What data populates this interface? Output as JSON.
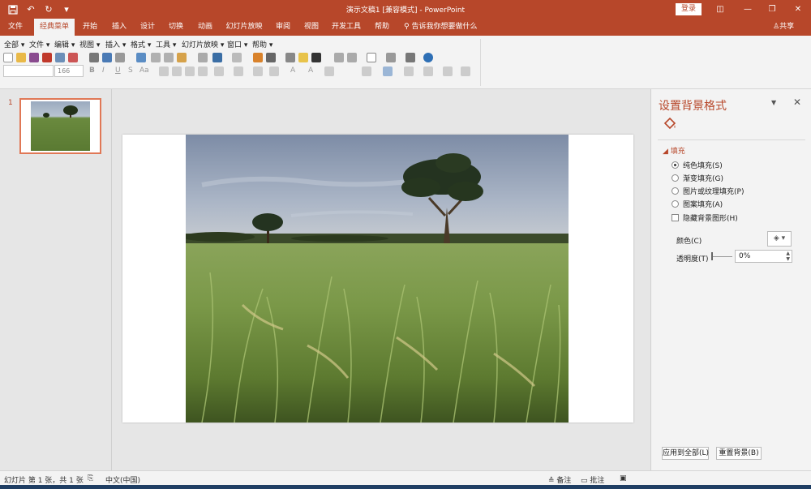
{
  "window": {
    "title": "演示文稿1 [兼容模式] - PowerPoint",
    "login_label": "登录",
    "controls": {
      "ribbon_display": "◫",
      "minimize": "—",
      "restore": "❐",
      "close": "✕"
    }
  },
  "quick_access": [
    "save-icon",
    "undo-icon",
    "redo-icon",
    "customize-icon"
  ],
  "tabs": [
    {
      "label": "文件",
      "active": false
    },
    {
      "label": "经典菜单",
      "active": true
    },
    {
      "label": "开始",
      "active": false
    },
    {
      "label": "插入",
      "active": false
    },
    {
      "label": "设计",
      "active": false
    },
    {
      "label": "切换",
      "active": false
    },
    {
      "label": "动画",
      "active": false
    },
    {
      "label": "幻灯片放映",
      "active": false
    },
    {
      "label": "审阅",
      "active": false
    },
    {
      "label": "视图",
      "active": false
    },
    {
      "label": "开发工具",
      "active": false
    },
    {
      "label": "帮助",
      "active": false
    }
  ],
  "tell_me": "告诉我你想要做什么",
  "share_label": "共享",
  "classic_menu": [
    "全部",
    "文件",
    "编辑",
    "视图",
    "插入",
    "格式",
    "工具",
    "幻灯片放映",
    "窗口",
    "帮助"
  ],
  "font_size_value": "166",
  "slides": [
    {
      "number": "1"
    }
  ],
  "format_pane": {
    "title": "设置背景格式",
    "section": "填充",
    "options": [
      {
        "label": "纯色填充(S)",
        "checked": true
      },
      {
        "label": "渐变填充(G)",
        "checked": false
      },
      {
        "label": "图片或纹理填充(P)",
        "checked": false
      },
      {
        "label": "图案填充(A)",
        "checked": false
      }
    ],
    "hide_graphics_label": "隐藏背景图形(H)",
    "color_label": "颜色(C)",
    "transparency_label": "透明度(T)",
    "transparency_value": "0%",
    "transparency_level": 0,
    "apply_all_label": "应用到全部(L)",
    "reset_label": "重置背景(B)"
  },
  "status": {
    "slide_info": "幻灯片 第 1 张，共 1 张",
    "language": "中文(中国)",
    "notes_label": "备注",
    "comments_label": "批注"
  },
  "colors": {
    "accent": "#b7472a",
    "ribbon": "#f3f3f3",
    "canvas": "#e6e6e6"
  }
}
